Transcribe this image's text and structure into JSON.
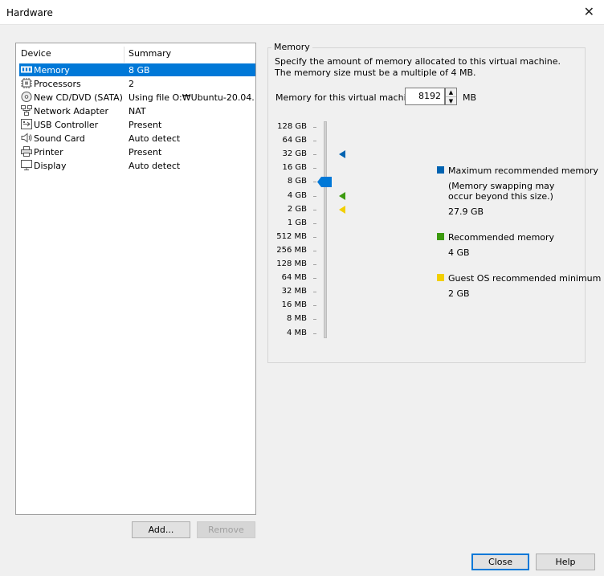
{
  "window": {
    "title": "Hardware",
    "close_glyph": "✕"
  },
  "device_list": {
    "headers": {
      "device": "Device",
      "summary": "Summary"
    },
    "items": [
      {
        "name": "Memory",
        "summary": "8 GB",
        "icon": "memory-icon",
        "selected": true
      },
      {
        "name": "Processors",
        "summary": "2",
        "icon": "processor-icon"
      },
      {
        "name": "New CD/DVD (SATA)",
        "summary": "Using file O:₩Ubuntu-20.04...",
        "icon": "cd-dvd-icon"
      },
      {
        "name": "Network Adapter",
        "summary": "NAT",
        "icon": "network-adapter-icon"
      },
      {
        "name": "USB Controller",
        "summary": "Present",
        "icon": "usb-controller-icon"
      },
      {
        "name": "Sound Card",
        "summary": "Auto detect",
        "icon": "sound-card-icon"
      },
      {
        "name": "Printer",
        "summary": "Present",
        "icon": "printer-icon"
      },
      {
        "name": "Display",
        "summary": "Auto detect",
        "icon": "display-icon"
      }
    ]
  },
  "buttons": {
    "add": "Add...",
    "remove": "Remove",
    "close": "Close",
    "help": "Help"
  },
  "memory": {
    "group_title": "Memory",
    "description": "Specify the amount of memory allocated to this virtual machine. The memory size must be a multiple of 4 MB.",
    "input_label": "Memory for this virtual machine:",
    "value": "8192",
    "unit": "MB",
    "scale": [
      "128 GB",
      "64 GB",
      "32 GB",
      "16 GB",
      "8 GB",
      "4 GB",
      "2 GB",
      "1 GB",
      "512 MB",
      "256 MB",
      "128 MB",
      "64 MB",
      "32 MB",
      "16 MB",
      "8 MB",
      "4 MB"
    ],
    "selected_scale_label": "8 GB",
    "legend": {
      "maximum": {
        "label": "Maximum recommended memory",
        "note1": "(Memory swapping may",
        "note2": "occur beyond this size.)",
        "value": "27.9 GB",
        "color": "#0063b1",
        "scale_label": "32 GB"
      },
      "recommended": {
        "label": "Recommended memory",
        "value": "4 GB",
        "color": "#3c9a0f",
        "scale_label": "4 GB"
      },
      "guest_min": {
        "label": "Guest OS recommended minimum",
        "value": "2 GB",
        "color": "#f2cf00",
        "scale_label": "2 GB"
      }
    }
  }
}
